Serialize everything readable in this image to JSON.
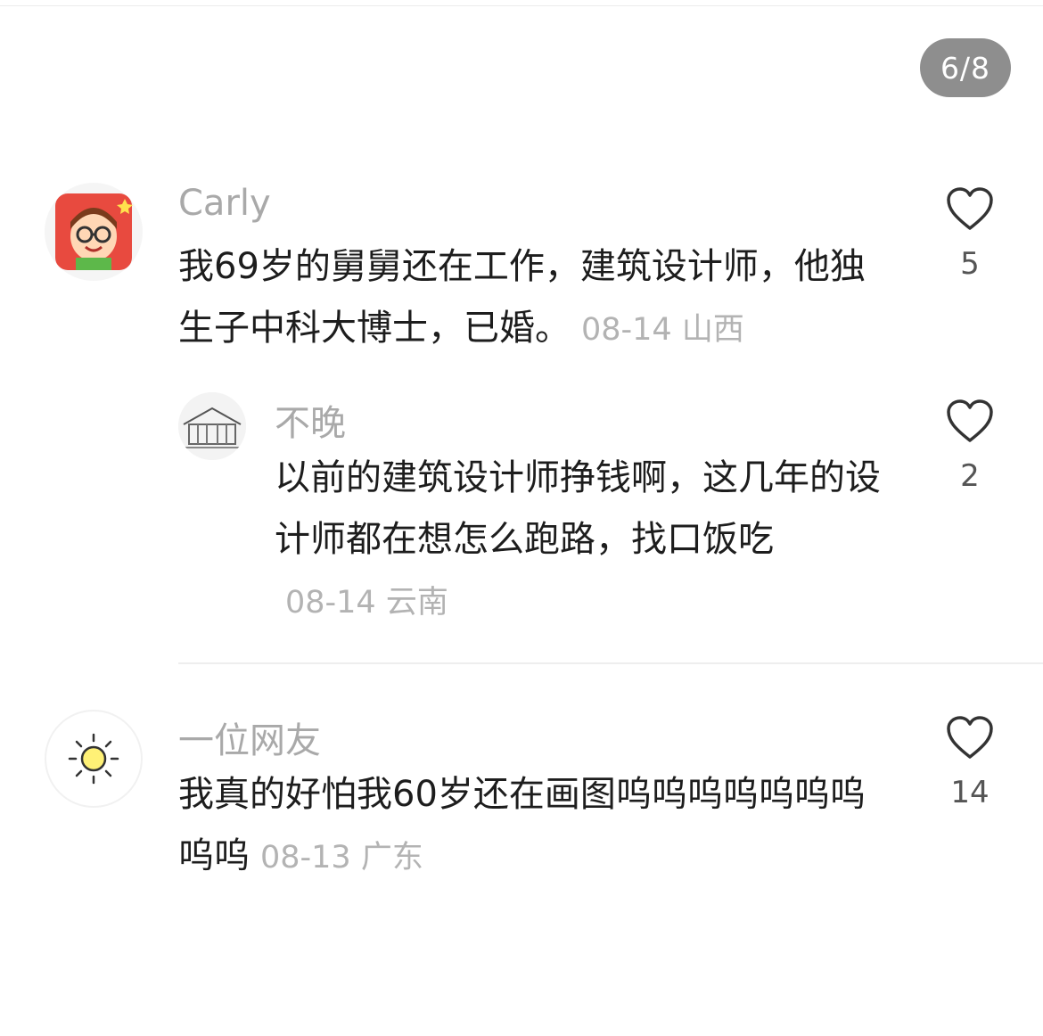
{
  "page_indicator": "6/8",
  "comments": [
    {
      "username": "Carly",
      "text": "我69岁的舅舅还在工作，建筑设计师，他独生子中科大博士，已婚。",
      "date": "08-14",
      "location": "山西",
      "likes": "5",
      "avatar_icon": "cartoon-girl-avatar"
    },
    {
      "username": "不晚",
      "text": "以前的建筑设计师挣钱啊，这几年的设计师都在想怎么跑路，找口饭吃",
      "date": "08-14",
      "location": "云南",
      "likes": "2",
      "avatar_icon": "building-sketch-avatar",
      "is_reply": true
    },
    {
      "username": "一位网友",
      "text": "我真的好怕我60岁还在画图呜呜呜呜呜呜呜呜呜",
      "date": "08-13",
      "location": "广东",
      "likes": "14",
      "avatar_icon": "sun-avatar"
    }
  ],
  "icons": {
    "like": "heart-outline-icon"
  }
}
